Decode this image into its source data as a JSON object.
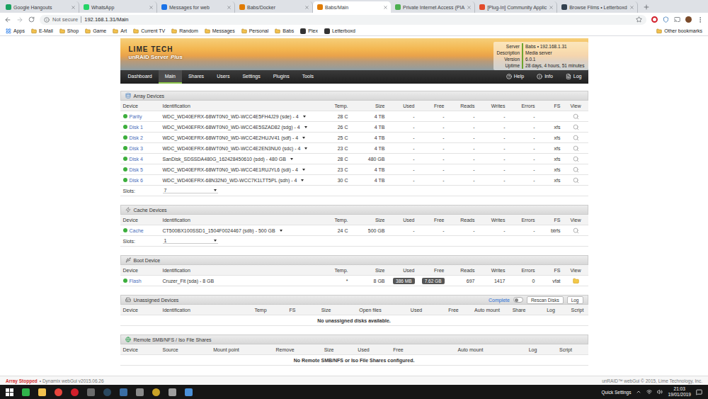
{
  "browser": {
    "tabs": [
      {
        "title": "Google Hangouts",
        "selected": false
      },
      {
        "title": "WhatsApp",
        "selected": false
      },
      {
        "title": "Messages for web",
        "selected": false
      },
      {
        "title": "Babs/Docker",
        "selected": false
      },
      {
        "title": "Babs/Main",
        "selected": true
      },
      {
        "title": "Private Internet Access (PIA",
        "selected": false
      },
      {
        "title": "[Plug-In] Community Applic",
        "selected": false
      },
      {
        "title": "Browse Films • Letterboxd",
        "selected": false
      }
    ],
    "address": {
      "security": "Not secure",
      "url": "192.168.1.31/Main"
    },
    "bookmarks": [
      {
        "label": "Apps",
        "kind": "apps"
      },
      {
        "label": "E-Mail",
        "kind": "folder"
      },
      {
        "label": "Shop",
        "kind": "folder"
      },
      {
        "label": "Game",
        "kind": "folder"
      },
      {
        "label": "Art",
        "kind": "folder"
      },
      {
        "label": "Current TV",
        "kind": "folder"
      },
      {
        "label": "Random",
        "kind": "folder"
      },
      {
        "label": "Messages",
        "kind": "folder"
      },
      {
        "label": "Personal",
        "kind": "folder"
      },
      {
        "label": "Babs",
        "kind": "folder"
      },
      {
        "label": "Plex",
        "kind": "site"
      },
      {
        "label": "Letterboxd",
        "kind": "site"
      }
    ],
    "other_bookmarks": "Other bookmarks"
  },
  "header": {
    "logo_top": "LIME TECH",
    "logo_bottom": "unRAID Server",
    "logo_edition": "Plus",
    "info": [
      {
        "label": "Server",
        "value": "Babs • 192.168.1.31"
      },
      {
        "label": "Description",
        "value": "Media server"
      },
      {
        "label": "Version",
        "value": "6.0.1"
      },
      {
        "label": "Uptime",
        "value": "28 days, 4 hours, 51 minutes"
      }
    ]
  },
  "nav": {
    "items": [
      {
        "label": "Dashboard",
        "selected": false
      },
      {
        "label": "Main",
        "selected": true
      },
      {
        "label": "Shares",
        "selected": false
      },
      {
        "label": "Users",
        "selected": false
      },
      {
        "label": "Settings",
        "selected": false
      },
      {
        "label": "Plugins",
        "selected": false
      },
      {
        "label": "Tools",
        "selected": false
      }
    ],
    "right": [
      {
        "label": "Help",
        "kind": "help"
      },
      {
        "label": "Info",
        "kind": "info"
      },
      {
        "label": "Log",
        "kind": "log"
      }
    ]
  },
  "sections": [
    {
      "kind": "array",
      "title": "Array Devices",
      "columns": [
        "Device",
        "Identification",
        "Temp.",
        "Size",
        "Used",
        "Free",
        "Reads",
        "Writes",
        "Errors",
        "FS",
        "View"
      ],
      "rows": [
        {
          "device": "Parity",
          "online": true,
          "kind": "disk",
          "cells": [
            "WDC_WD40EFRX-68WT0N0_WD-WCC4E5FH4J29 (sde) - 4",
            "28 C",
            "4 TB",
            "-",
            "-",
            "-",
            "-",
            "-",
            ""
          ]
        },
        {
          "device": "Disk 1",
          "online": true,
          "kind": "disk",
          "cells": [
            "WDC_WD40EFRX-68WT0N0_WD-WCC4E5SZAD82 (sdg) - 4",
            "26 C",
            "4 TB",
            "-",
            "-",
            "-",
            "-",
            "-",
            "xfs"
          ]
        },
        {
          "device": "Disk 2",
          "online": true,
          "kind": "disk",
          "cells": [
            "WDC_WD40EFRX-68WT0N0_WD-WCC4E2HUJV41 (sdf) - 4",
            "25 C",
            "4 TB",
            "-",
            "-",
            "-",
            "-",
            "-",
            "xfs"
          ]
        },
        {
          "device": "Disk 3",
          "online": true,
          "kind": "disk",
          "cells": [
            "WDC_WD40EFRX-68WT0N0_WD-WCC4E2EN3NU0 (sdc) - 4",
            "23 C",
            "4 TB",
            "-",
            "-",
            "-",
            "-",
            "-",
            "xfs"
          ]
        },
        {
          "device": "Disk 4",
          "online": true,
          "kind": "disk",
          "cells": [
            "SanDisk_SDSSDA480G_162428450610 (sdd) - 480 GB",
            "28 C",
            "480 GB",
            "-",
            "-",
            "-",
            "-",
            "-",
            "xfs"
          ]
        },
        {
          "device": "Disk 5",
          "online": true,
          "kind": "disk",
          "cells": [
            "WDC_WD40EFRX-68WT0N0_WD-WCC4E1RUJYL6 (sdi) - 4",
            "23 C",
            "4 TB",
            "-",
            "-",
            "-",
            "-",
            "-",
            "xfs"
          ]
        },
        {
          "device": "Disk 6",
          "online": true,
          "kind": "disk",
          "cells": [
            "WDC_WD40EFRX-68N32N0_WD-WCC7K1LTT5PL (sdh) - 4",
            "30 C",
            "4 TB",
            "-",
            "-",
            "-",
            "-",
            "-",
            "xfs"
          ]
        }
      ],
      "slots": {
        "label": "Slots:",
        "value": "7"
      }
    },
    {
      "kind": "cache",
      "title": "Cache Devices",
      "columns": [
        "Device",
        "Identification",
        "Temp.",
        "Size",
        "Used",
        "Free",
        "Reads",
        "Writes",
        "Errors",
        "FS",
        "View"
      ],
      "rows": [
        {
          "device": "Cache",
          "online": true,
          "kind": "disk",
          "cells": [
            "CT500BX100SSD1_1504F0024467 (sdb) - 500 GB",
            "24 C",
            "500 GB",
            "-",
            "-",
            "-",
            "-",
            "-",
            "btrfs"
          ]
        }
      ],
      "slots": {
        "label": "Slots:",
        "value": "1"
      }
    },
    {
      "kind": "boot",
      "title": "Boot Device",
      "columns": [
        "Device",
        "Identification",
        "Temp.",
        "Size",
        "Used",
        "Free",
        "Reads",
        "Writes",
        "Errors",
        "FS",
        "View"
      ],
      "rows": [
        {
          "device": "Flash",
          "online": true,
          "kind": "flash",
          "cells": [
            "Cruzer_Fit (sda) - 8 GB",
            "*",
            "8 GB",
            "386 MB",
            "7.62 GB",
            "697",
            "1417",
            "0",
            "vfat"
          ]
        }
      ]
    },
    {
      "kind": "unassigned",
      "title": "Unassigned Devices",
      "tools": {
        "status": "Complete",
        "toggle_on": false,
        "buttons": [
          "Rescan Disks",
          "Log"
        ]
      },
      "columns": [
        "Device",
        "Identification",
        "Temp",
        "FS",
        "Size",
        "Open files",
        "Used",
        "Free",
        "Auto mount",
        "Share",
        "Log",
        "Script"
      ],
      "rows": [],
      "empty": "No unassigned disks available."
    },
    {
      "kind": "remote",
      "title": "Remote SMB/NFS / Iso File Shares",
      "columns": [
        "Device",
        "Source",
        "Mount point",
        "Remove",
        "Size",
        "Used",
        "Free",
        "Auto mount",
        "Log",
        "Script"
      ],
      "rows": [],
      "empty": "No Remote SMB/NFS or Iso File Shares configured."
    }
  ],
  "status_bar": {
    "state": "Array Stopped",
    "version": "• Dynamix webGui v2015.06.26",
    "copyright": "unRAID™ webGui © 2015, Lime Technology, Inc."
  },
  "taskbar": {
    "quick_settings": "Quick Settings",
    "time": "21:03",
    "date": "19/01/2019"
  }
}
